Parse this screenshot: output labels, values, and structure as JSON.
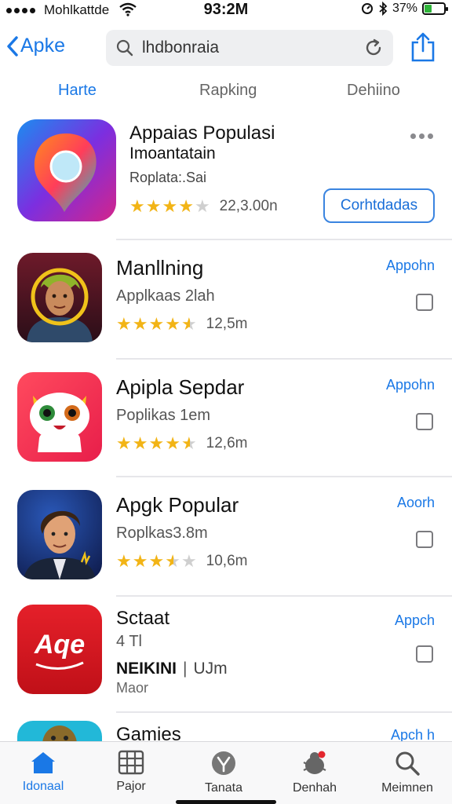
{
  "status_bar": {
    "carrier": "Mohlkattde",
    "time": "93:2M",
    "battery": "37%",
    "battery_level": 0.37
  },
  "nav": {
    "back_label": "Apke",
    "search_value": "lhdbonraia"
  },
  "segments": [
    {
      "label": "Harte",
      "active": true
    },
    {
      "label": "Rapking",
      "active": false
    },
    {
      "label": "Dehiino",
      "active": false
    }
  ],
  "featured": {
    "title": "Appaias Populasi",
    "subtitle": "Imoantatain",
    "category": "Roplata:.Sai",
    "rating": 4,
    "rating_count": "22,3.00n",
    "get_label": "Corhtdadas"
  },
  "apps": [
    {
      "title": "Manllning",
      "subtitle": "Applkaas 2lah",
      "rating": 4.5,
      "rating_count": "12,5m",
      "action": "Appohn",
      "icon": "portrait-icon"
    },
    {
      "title": "Apipla Sepdar",
      "subtitle": "Poplikas 1em",
      "rating": 4.5,
      "rating_count": "12,6m",
      "action": "Appohn",
      "icon": "cat-icon"
    },
    {
      "title": "Apgk Popular",
      "subtitle": "Roplkas3.8m",
      "rating": 3.5,
      "rating_count": "10,6m",
      "action": "Aoorh",
      "icon": "man-portrait-icon"
    },
    {
      "title": "Sctaat",
      "subtitle": "4 Tl",
      "extra": "NEIKINI",
      "extra2": "UJm",
      "extra3": "Maor",
      "action": "Appch",
      "icon": "aqe-logo-icon",
      "logo_text": "Aqe"
    },
    {
      "title": "Gamies",
      "action": "Apch h",
      "icon": "game-icon"
    }
  ],
  "tab_bar": [
    {
      "label": "Idonaal",
      "icon": "home-icon",
      "active": true
    },
    {
      "label": "Pajor",
      "icon": "grid-icon",
      "active": false
    },
    {
      "label": "Tanata",
      "icon": "compass-icon",
      "active": false
    },
    {
      "label": "Denhah",
      "icon": "bug-icon",
      "active": false
    },
    {
      "label": "Meimnen",
      "icon": "search-icon",
      "active": false
    }
  ],
  "colors": {
    "accent": "#1a78e6",
    "star": "#f2b416",
    "battery": "#2fb53a"
  }
}
